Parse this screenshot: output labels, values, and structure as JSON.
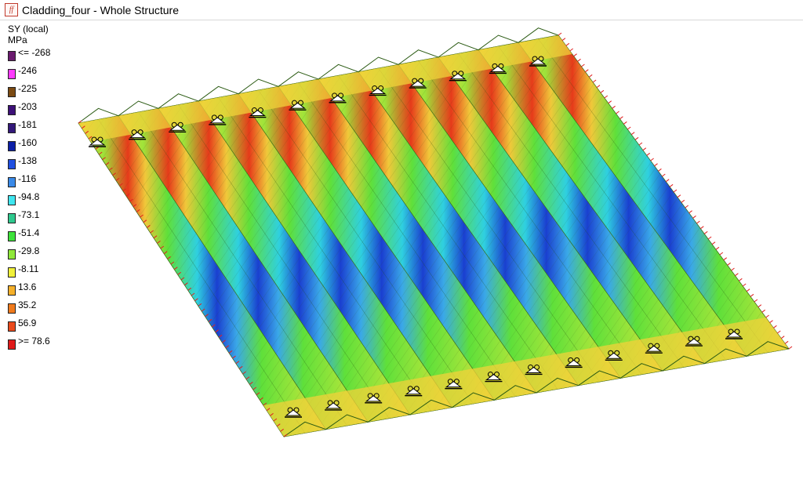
{
  "window": {
    "icon_glyph": "ff",
    "title": "Cladding_four - Whole Structure"
  },
  "legend": {
    "quantity": "SY (local)",
    "unit": "MPa",
    "entries": [
      {
        "label": "<= -268",
        "color": "#6a1a6e"
      },
      {
        "label": "-246",
        "color": "#ff3bff"
      },
      {
        "label": "-225",
        "color": "#7b4a12"
      },
      {
        "label": "-203",
        "color": "#3d1078"
      },
      {
        "label": "-181",
        "color": "#33197a"
      },
      {
        "label": "-160",
        "color": "#0c1fa6"
      },
      {
        "label": "-138",
        "color": "#1f4fe0"
      },
      {
        "label": "-116",
        "color": "#3a8ae8"
      },
      {
        "label": "-94.8",
        "color": "#3fe6f0"
      },
      {
        "label": "-73.1",
        "color": "#2ec98e"
      },
      {
        "label": "-51.4",
        "color": "#3de23a"
      },
      {
        "label": "-29.8",
        "color": "#8fe83a"
      },
      {
        "label": "-8.11",
        "color": "#f0f03a"
      },
      {
        "label": "13.6",
        "color": "#f5b02a"
      },
      {
        "label": "35.2",
        "color": "#f07a1c"
      },
      {
        "label": "56.9",
        "color": "#ea4a1c"
      },
      {
        "label": ">= 78.6",
        "color": "#e01a1a"
      }
    ]
  },
  "model": {
    "corrugation_count": 12,
    "support_icon": "pinned-support-icon",
    "support_rows": [
      "top-edge",
      "bottom-edge"
    ],
    "stress_colors": {
      "base": "#7ee03a",
      "edge_band": "#f2d23a",
      "tension": "#e63a1a",
      "compression_mid": "#2fd0e0",
      "compression_high": "#1a3fd0"
    }
  }
}
